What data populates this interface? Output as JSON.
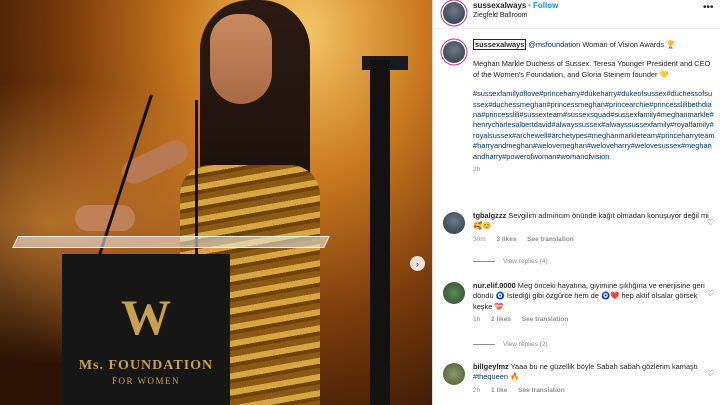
{
  "post": {
    "podium": {
      "logo": "W",
      "org": "Ms. FOUNDATION",
      "sub": "FOR WOMEN"
    }
  },
  "header": {
    "username": "sussexalways",
    "separator": "•",
    "follow_label": "Follow",
    "location": "Ziegfeld Ballroom",
    "more_icon": "more-horizontal-icon"
  },
  "caption": {
    "username": "sussexalways",
    "mention": "@msfoundation",
    "headline": " Woman of Vision Awards",
    "headline_emoji": "🏆",
    "body": "Meghan Markle Duchess of Sussex. Teresa Younger President and CEO of the Women's Foundation, and Gloria Steinem founder",
    "body_emoji": "💛",
    "hashtags": "#sussexfamilyoflove#princeharry#dukeharry#dukeofsussex#duchessofsussex#duchessmeghan#princessmeghan#princearchie#princesslilibethdiana#princesslili#sussexteam#sussexsquad#sussexfamily#meghanmarkle#henrycharlesalbertdavid#alwayssussex#alwayssussexfamily#royalfamily#royalsussex#archewell#archetypes#meghanmarkleteam#princeharryteam#harryandmeghan#welovemeghan#weloveharry#welovesussex#meghanandharry#powerofwoman#womanofvision",
    "time": "2h"
  },
  "comments": [
    {
      "user": "tgbalgzzz",
      "text": "Sevgilim admincim önünde kağıt olmadan konuşuyor değil mi",
      "emoji": "🥰😊",
      "age": "30m",
      "likes": "3 likes",
      "reply": "See translation",
      "replies": "View replies (4)"
    },
    {
      "user": "nur.elif.0000",
      "text_a": "Meg önceki hayatına, giyimine şıklığına ve enerjisine geri döndü",
      "emoji_a": "🧿",
      "text_b": " İstediği gibi özgürce hem de",
      "emoji_b": "🧿❤️",
      "text_c": " hep aktif olsalar görsek keşke",
      "emoji_c": "💝",
      "age": "1h",
      "likes": "2 likes",
      "reply": "See translation",
      "replies": "View replies (2)"
    },
    {
      "user": "billgeylmz",
      "text": "Yaaa bu ne güzellik böyle Sabah sabah gözlerim kamaştı",
      "tag": "#thequeen",
      "emoji": "🔥",
      "age": "2h",
      "likes": "1 like",
      "reply": "See translation"
    }
  ],
  "icons": {
    "next": "chevron-right-icon",
    "like": "heart-icon"
  }
}
